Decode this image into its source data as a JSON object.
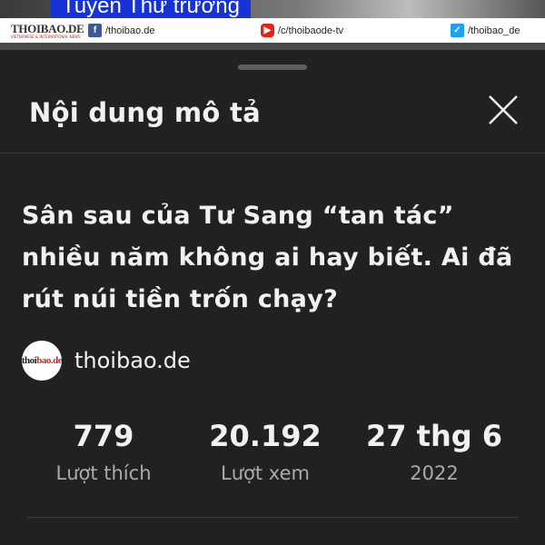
{
  "video_overlay": {
    "caption": "Tuyên Thứ trưởng",
    "logo_main": "THOIBAO.DE",
    "logo_sub": "VIETNAMESE & INTERNATIONAL NEWS",
    "facebook": "/thoibao.de",
    "youtube": "/c/thoibaode-tv",
    "twitter": "/thoibao_de"
  },
  "sheet": {
    "title": "Nội dung mô tả",
    "video_title": "Sân sau của Tư Sang “tan tác” nhiều năm không ai hay biết. Ai đã rút núi tiền trốn chạy?",
    "channel": {
      "avatar_text_a": "thoi",
      "avatar_text_b": "bao.de",
      "name": "thoibao.de"
    },
    "stats": [
      {
        "value": "779",
        "label": "Lượt thích"
      },
      {
        "value": "20.192",
        "label": "Lượt xem"
      },
      {
        "value": "27 thg 6",
        "label": "2022"
      }
    ]
  },
  "icons": {
    "close": "close-icon",
    "facebook": "facebook-icon",
    "youtube": "youtube-icon",
    "twitter": "twitter-icon"
  },
  "colors": {
    "background": "#212121",
    "text": "#f1f1f1",
    "secondary_text": "#aaaaaa",
    "caption_bg": "#1733d6"
  }
}
